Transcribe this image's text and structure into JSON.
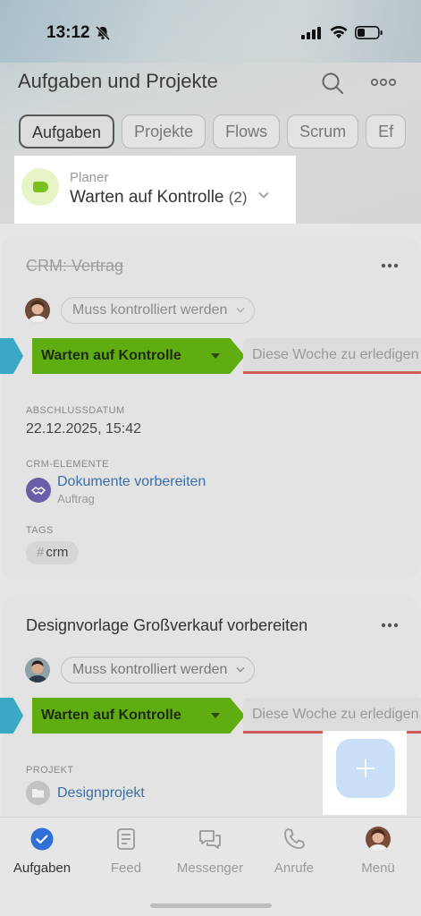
{
  "status": {
    "time": "13:12"
  },
  "header": {
    "title": "Aufgaben und Projekte",
    "search_icon": "search-icon",
    "more_icon": "more-icon"
  },
  "tabs": [
    {
      "label": "Aufgaben",
      "active": true
    },
    {
      "label": "Projekte",
      "active": false
    },
    {
      "label": "Flows",
      "active": false
    },
    {
      "label": "Scrum",
      "active": false
    },
    {
      "label": "Ef",
      "active": false
    }
  ],
  "planer": {
    "label": "Planer",
    "value": "Warten auf Kontrolle",
    "count": "(2)",
    "color": "#7ac11f"
  },
  "tasks": [
    {
      "title": "CRM: Vertrag",
      "status_pill": "Muss kontrolliert werden",
      "stage": "Warten auf Kontrolle",
      "deadline_text": "Diese Woche zu erledigen",
      "closing_date_label": "ABSCHLUSSDATUM",
      "closing_date": "22.12.2025, 15:42",
      "crm_label": "CRM-ELEMENTE",
      "crm_item": "Dokumente vorbereiten",
      "crm_item_type": "Auftrag",
      "tags_label": "TAGS",
      "tag": "crm"
    },
    {
      "title": "Designvorlage Großverkauf vorbereiten",
      "status_pill": "Muss kontrolliert werden",
      "stage": "Warten auf Kontrolle",
      "deadline_text": "Diese Woche zu erledigen",
      "project_label": "PROJEKT",
      "project": "Designprojekt"
    }
  ],
  "colors": {
    "stage_green": "#5fad10",
    "stage_blue": "#3aa9c5",
    "overdue_red": "#cf5a5a",
    "link_blue": "#3b6ea6",
    "fab": "#c9dff7"
  },
  "bottom_nav": [
    {
      "label": "Aufgaben",
      "icon": "check-circle-icon",
      "active": true
    },
    {
      "label": "Feed",
      "icon": "feed-icon",
      "active": false
    },
    {
      "label": "Messenger",
      "icon": "chat-icon",
      "active": false
    },
    {
      "label": "Anrufe",
      "icon": "phone-icon",
      "active": false
    },
    {
      "label": "Menü",
      "icon": "avatar",
      "active": false
    }
  ]
}
